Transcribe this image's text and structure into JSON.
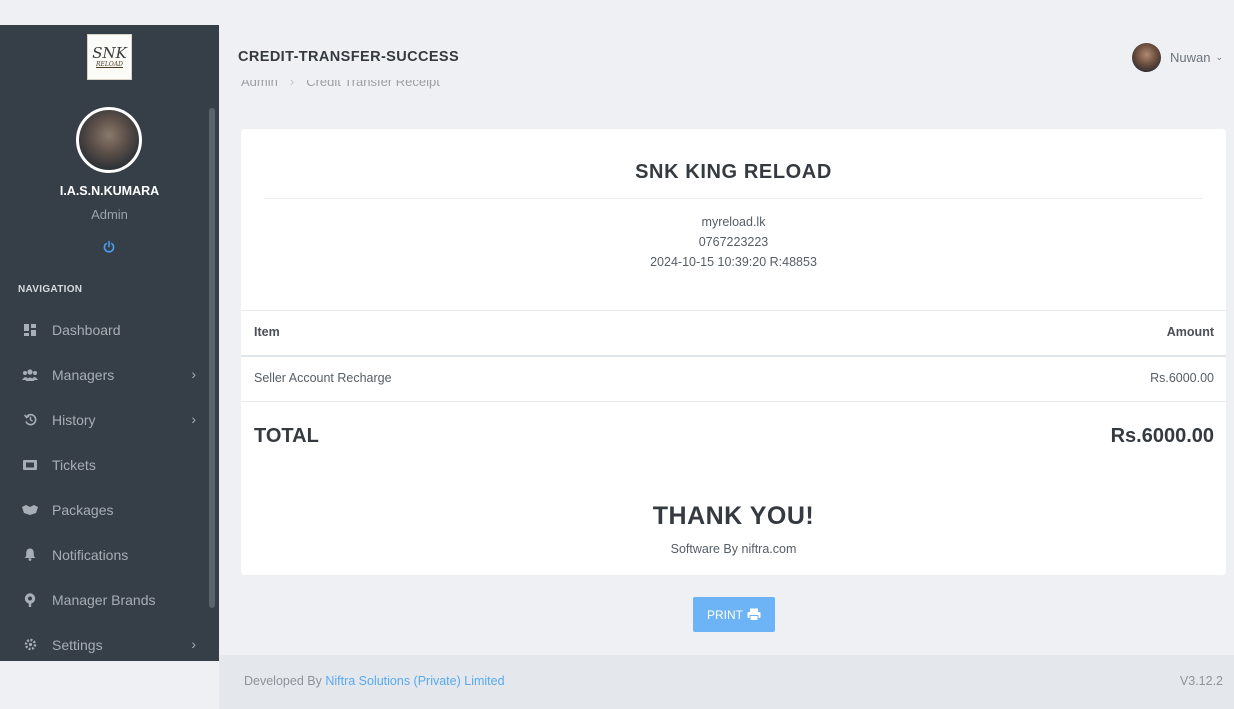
{
  "app": {
    "logo_text": "SNK",
    "logo_subtext": "RELOAD"
  },
  "sidebar": {
    "user_name": "I.A.S.N.KUMARA",
    "user_role": "Admin",
    "nav_title": "NAVIGATION",
    "items": [
      {
        "label": "Dashboard",
        "icon": "dashboard-icon",
        "has_submenu": false
      },
      {
        "label": "Managers",
        "icon": "users-icon",
        "has_submenu": true
      },
      {
        "label": "History",
        "icon": "history-icon",
        "has_submenu": true
      },
      {
        "label": "Tickets",
        "icon": "ticket-icon",
        "has_submenu": false
      },
      {
        "label": "Packages",
        "icon": "packages-icon",
        "has_submenu": false
      },
      {
        "label": "Notifications",
        "icon": "bell-icon",
        "has_submenu": false
      },
      {
        "label": "Manager Brands",
        "icon": "brand-icon",
        "has_submenu": false
      },
      {
        "label": "Settings",
        "icon": "settings-icon",
        "has_submenu": true
      }
    ]
  },
  "header": {
    "title": "CREDIT-TRANSFER-SUCCESS",
    "user_name": "Nuwan",
    "breadcrumb": [
      "Admin",
      "Credit Transfer Receipt"
    ]
  },
  "receipt": {
    "shop_name": "SNK KING RELOAD",
    "website": "myreload.lk",
    "phone": "0767223223",
    "datetime_ref": "2024-10-15 10:39:20 R:48853",
    "columns": {
      "item": "Item",
      "amount": "Amount"
    },
    "rows": [
      {
        "item": "Seller Account Recharge",
        "amount": "Rs.6000.00"
      }
    ],
    "total_label": "TOTAL",
    "total_value": "Rs.6000.00",
    "thank_you": "THANK YOU!",
    "software_by": "Software By niftra.com"
  },
  "print_label": "PRINT",
  "footer": {
    "prefix": "Developed By ",
    "company": "Niftra Solutions (Private) Limited",
    "version": "V3.12.2"
  },
  "colors": {
    "sidebar_bg": "#363e47",
    "accent": "#6cb4f6",
    "link": "#5aaaf0"
  }
}
